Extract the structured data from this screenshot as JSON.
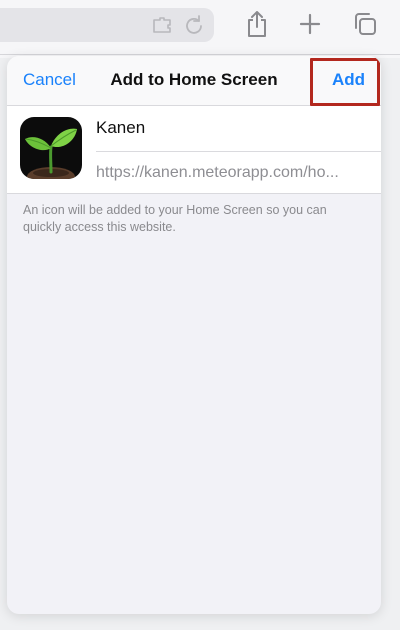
{
  "browser": {
    "icons": [
      "puzzle-icon",
      "reload-icon",
      "share-icon",
      "plus-icon",
      "tabs-icon"
    ],
    "background_link": "n"
  },
  "sheet": {
    "cancel_label": "Cancel",
    "title": "Add to Home Screen",
    "add_label": "Add"
  },
  "form": {
    "name_value": "Kanen",
    "url_value": "https://kanen.meteorapp.com/ho..."
  },
  "helper_text": "An icon will be added to your Home Screen so you can quickly access this website.",
  "colors": {
    "accent": "#1a82fb",
    "highlight": "#b3281e",
    "background_link": "#d9532a"
  }
}
